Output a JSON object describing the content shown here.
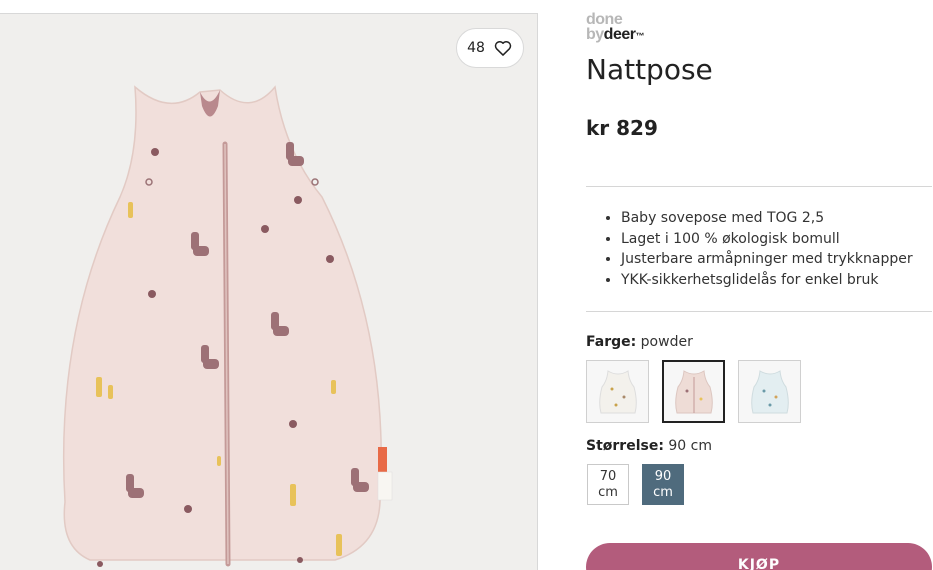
{
  "favorites": {
    "count": "48",
    "icon": "heart-icon"
  },
  "brand": {
    "line1": "done",
    "line2_by": "by",
    "line2_deer": "deer",
    "mark": "™"
  },
  "product": {
    "title": "Nattpose",
    "price": "kr 829",
    "features": [
      "Baby sovepose med TOG 2,5",
      "Laget i 100 % økologisk bomull",
      "Justerbare armåpninger med trykknapper",
      "YKK-sikkerhetsglidelås for enkel bruk"
    ]
  },
  "color": {
    "label": "Farge:",
    "value": "powder",
    "swatches": [
      {
        "name": "white",
        "color": "#f3f1ec",
        "selected": false
      },
      {
        "name": "powder",
        "color": "#eedcd6",
        "selected": true
      },
      {
        "name": "blue",
        "color": "#e3eef1",
        "selected": false
      }
    ]
  },
  "size": {
    "label": "Størrelse:",
    "value": "90 cm",
    "options": [
      {
        "num": "70",
        "unit": "cm",
        "selected": false
      },
      {
        "num": "90",
        "unit": "cm",
        "selected": true
      }
    ]
  },
  "buy": {
    "label": "KJØP"
  },
  "colors": {
    "accent": "#b35c7c",
    "selected_size": "#4f6b7d",
    "bag": "#f1dfdb",
    "bag_lining": "#b9898d"
  }
}
